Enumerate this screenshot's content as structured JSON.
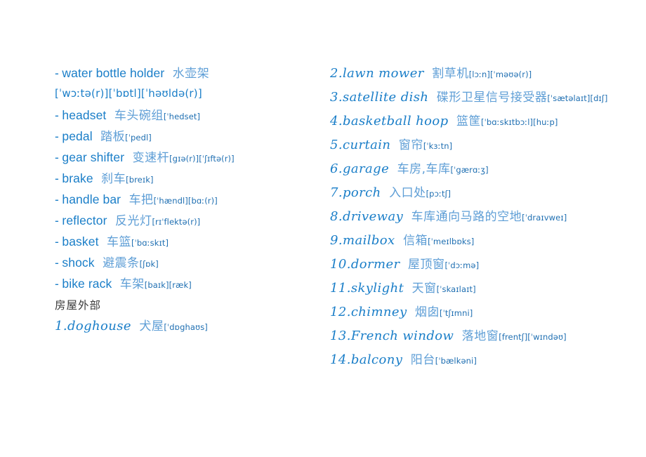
{
  "colors": {
    "headword_blue": "#1a7ec8",
    "gloss_blue": "#5e9ed6",
    "ipa_blue": "#1f6fb2",
    "heading_gray": "#3a3a3a",
    "background": "#ffffff"
  },
  "left_column": {
    "entries": [
      {
        "bullet": "-",
        "term": "water bottle holder",
        "cn": "水壶架",
        "ipa": ""
      },
      {
        "bullet": "",
        "term": "",
        "cn": "",
        "ipa_large": "[ˈwɔːtə(r)][ˈbɒtl][ˈhəʊldə(r)]"
      },
      {
        "bullet": "-",
        "term": "headset",
        "cn": "车头碗组",
        "ipa": "[ˈhedset]"
      },
      {
        "bullet": "-",
        "term": "pedal",
        "cn": "踏板",
        "ipa": "[ˈpedl]"
      },
      {
        "bullet": "-",
        "term": "gear shifter",
        "cn": "变速杆",
        "ipa": "[gɪə(r)][ˈʃɪftə(r)]"
      },
      {
        "bullet": "-",
        "term": "brake",
        "cn": "刹车",
        "ipa": "[breɪk]"
      },
      {
        "bullet": "-",
        "term": "handle bar",
        "cn": "车把",
        "ipa": "[ˈhændl][bɑː(r)]"
      },
      {
        "bullet": "-",
        "term": "reflector",
        "cn": "反光灯",
        "ipa": "[rɪˈflektə(r)]"
      },
      {
        "bullet": "-",
        "term": "basket",
        "cn": "车篮",
        "ipa": "[ˈbɑːskɪt]"
      },
      {
        "bullet": "-",
        "term": "shock",
        "cn": "避震条",
        "ipa": "[ʃɒk]"
      },
      {
        "bullet": "-",
        "term": "bike rack",
        "cn": "车架",
        "ipa": "[baɪk][ræk]"
      }
    ],
    "section_heading": "房屋外部",
    "numbered_entries": [
      {
        "term": "1.doghouse",
        "cn": "犬屋",
        "ipa": "[ˈdɒghaʊs]"
      }
    ]
  },
  "right_column": {
    "entries": [
      {
        "term": "2.lawn mower",
        "cn": "割草机",
        "ipa": "[lɔːn][ˈməʊə(r)]"
      },
      {
        "term": "3.satellite dish",
        "cn": "碟形卫星信号接受器",
        "ipa": "[ˈsætəlaɪt][dɪʃ]"
      },
      {
        "term": "4.basketball hoop",
        "cn": "篮筐",
        "ipa": "[ˈbɑːskɪtbɔːl][huːp]"
      },
      {
        "term": "5.curtain",
        "cn": "窗帘",
        "ipa": "[ˈkɜːtn]"
      },
      {
        "term": "6.garage",
        "cn": "车房,车库",
        "ipa": "[ˈgærɑːʒ]"
      },
      {
        "term": "7.porch",
        "cn": "入口处",
        "ipa": "[pɔːtʃ]"
      },
      {
        "term": "8.driveway",
        "cn": "车库通向马路的空地",
        "ipa": "[ˈdraɪvweɪ]"
      },
      {
        "term": "9.mailbox",
        "cn": "信箱",
        "ipa": "[ˈmeɪlbɒks]"
      },
      {
        "term": "10.dormer",
        "cn": "屋顶窗",
        "ipa": "[ˈdɔːmə]"
      },
      {
        "term": "11.skylight",
        "cn": "天窗",
        "ipa": "[ˈskaɪlaɪt]"
      },
      {
        "term": "12.chimney",
        "cn": "烟囱",
        "ipa": "[ˈtʃɪmni]"
      },
      {
        "term": "13.French window",
        "cn": "落地窗",
        "ipa": "[frentʃ][ˈwɪndəʊ]"
      },
      {
        "term": "14.balcony",
        "cn": "阳台",
        "ipa": "[ˈbælkəni]"
      }
    ]
  }
}
